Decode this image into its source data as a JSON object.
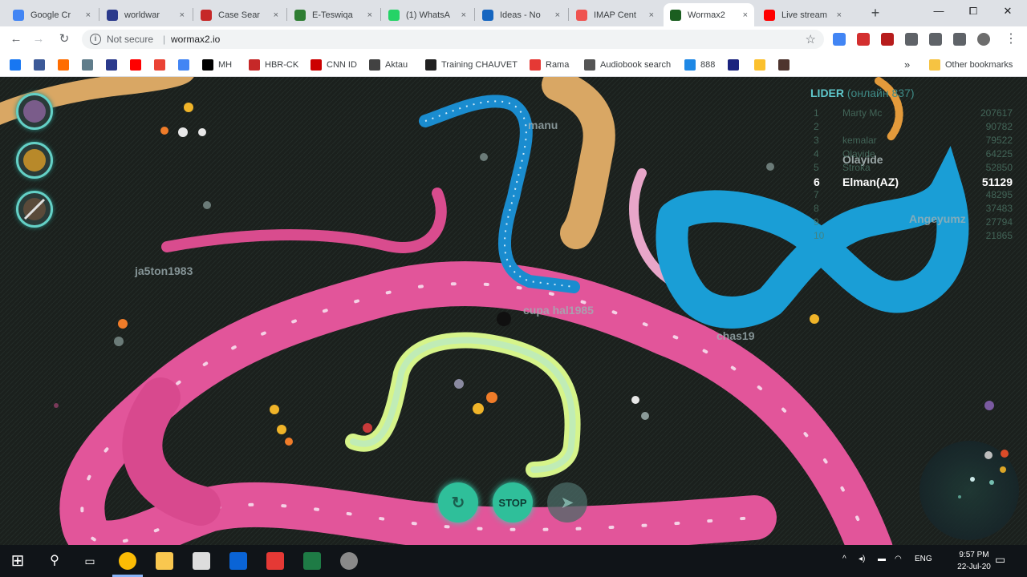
{
  "browser": {
    "tabs": [
      {
        "title": "Google Cr",
        "color": "#4285f4",
        "active": false
      },
      {
        "title": "worldwar",
        "color": "#2b3a8c",
        "active": false
      },
      {
        "title": "Case Sear",
        "color": "#c62828",
        "active": false
      },
      {
        "title": "E-Teswiqa",
        "color": "#2e7d32",
        "active": false
      },
      {
        "title": "(1) WhatsA",
        "color": "#25d366",
        "active": false
      },
      {
        "title": "Ideas - No",
        "color": "#1565c0",
        "active": false
      },
      {
        "title": "IMAP Cent",
        "color": "#ef5350",
        "active": false
      },
      {
        "title": "Wormax2",
        "color": "#1b5e20",
        "active": true
      },
      {
        "title": "Live stream",
        "color": "#ff0000",
        "active": false
      }
    ],
    "new_tab_label": "+",
    "close_glyph": "×",
    "window_controls": {
      "minimize": "—",
      "maximize": "⧠",
      "close": "✕"
    },
    "nav": {
      "back": "←",
      "forward": "→",
      "reload": "↻"
    },
    "address": {
      "security_text": "Not secure",
      "separator": "|",
      "url": "wormax2.io",
      "security_icon": "ⓘ",
      "star_icon": "☆"
    },
    "extensions": [
      {
        "name": "translate-extension-icon",
        "color": "#4285f4"
      },
      {
        "name": "adblock-extension-icon",
        "color": "#d32f2f"
      },
      {
        "name": "screenshot-extension-icon",
        "color": "#b71c1c"
      },
      {
        "name": "puzzle-extension-icon",
        "color": "#5f6368"
      },
      {
        "name": "cast-extension-icon",
        "color": "#5f6368"
      },
      {
        "name": "playlist-extension-icon",
        "color": "#5f6368"
      },
      {
        "name": "profile-avatar-icon",
        "color": "#6d6d6d"
      }
    ],
    "menu_icon": "⋮",
    "bookmarks": [
      {
        "label": "",
        "color": "#1877f2"
      },
      {
        "label": "",
        "color": "#3b5998"
      },
      {
        "label": "",
        "color": "#ff6d00"
      },
      {
        "label": "",
        "color": "#607d8b"
      },
      {
        "label": "",
        "color": "#2b3a8c"
      },
      {
        "label": "",
        "color": "#ff0000"
      },
      {
        "label": "",
        "color": "#ea4335"
      },
      {
        "label": "",
        "color": "#4285f4"
      },
      {
        "label": "MH",
        "color": "#000000"
      },
      {
        "label": "HBR-CK",
        "color": "#c62828"
      },
      {
        "label": "CNN ID",
        "color": "#cc0000"
      },
      {
        "label": "Aktau",
        "color": "#424242"
      },
      {
        "label": "Training CHAUVET",
        "color": "#212121"
      },
      {
        "label": "Rama",
        "color": "#e53935"
      },
      {
        "label": "Audiobook search",
        "color": "#555555"
      },
      {
        "label": "888",
        "color": "#1e88e5"
      },
      {
        "label": "",
        "color": "#1a237e"
      },
      {
        "label": "",
        "color": "#fbc02d"
      },
      {
        "label": "",
        "color": "#4e342e"
      }
    ],
    "bookmarks_overflow": "»",
    "other_bookmarks": "Other bookmarks"
  },
  "game": {
    "leaderboard": {
      "title": "LIDER",
      "subtitle": "(онлайн 837)",
      "rows": [
        {
          "rank": "1",
          "name": "Marty Mc",
          "score": "207617"
        },
        {
          "rank": "2",
          "name": "",
          "score": "90782"
        },
        {
          "rank": "3",
          "name": "kemalar",
          "score": "79522"
        },
        {
          "rank": "4",
          "name": "Olayide",
          "score": "64225"
        },
        {
          "rank": "5",
          "name": "Stroka",
          "score": "52850"
        },
        {
          "rank": "6",
          "name": "Elman(AZ)",
          "score": "51129",
          "me": true
        },
        {
          "rank": "7",
          "name": "",
          "score": "48295"
        },
        {
          "rank": "8",
          "name": "",
          "score": "37483"
        },
        {
          "rank": "9",
          "name": "",
          "score": "27794"
        },
        {
          "rank": "10",
          "name": "",
          "score": "21865"
        }
      ]
    },
    "nicknames": [
      {
        "text": "manu",
        "id": "nick-manu"
      },
      {
        "text": "Olayide",
        "id": "nick-olayide"
      },
      {
        "text": "Angeyumz",
        "id": "nick-angeyumz"
      },
      {
        "text": "ja5ton1983",
        "id": "nick-ja5ton1983"
      },
      {
        "text": "cupa  hal1985",
        "id": "nick-cupa"
      },
      {
        "text": "chas19",
        "id": "nick-chas19"
      }
    ],
    "buttons": {
      "boost": "",
      "stop": "STOP",
      "arrow": ""
    },
    "colors": {
      "pink": "#e2559a",
      "blue": "#1a9ed6",
      "tan": "#d9a764",
      "lime": "#d6f48a",
      "teal": "#39cfb0"
    }
  },
  "taskbar": {
    "start_icon": "⊞",
    "search_icon": "⚲",
    "apps": [
      {
        "name": "chrome-app-icon",
        "color": "#fbbc05"
      },
      {
        "name": "file-explorer-app-icon",
        "color": "#f9c74f"
      },
      {
        "name": "sketch-app-icon",
        "color": "#dddddd"
      },
      {
        "name": "outlook-app-icon",
        "color": "#0a64d6"
      },
      {
        "name": "acrobat-app-icon",
        "color": "#e53935"
      },
      {
        "name": "excel-app-icon",
        "color": "#1e7b45"
      },
      {
        "name": "recorder-app-icon",
        "color": "#8a8a8a"
      }
    ],
    "tray_language": "ENG",
    "clock_time": "9:57 PM",
    "clock_date": "22-Jul-20",
    "tray_up": "^",
    "notification_icon": "▭"
  }
}
